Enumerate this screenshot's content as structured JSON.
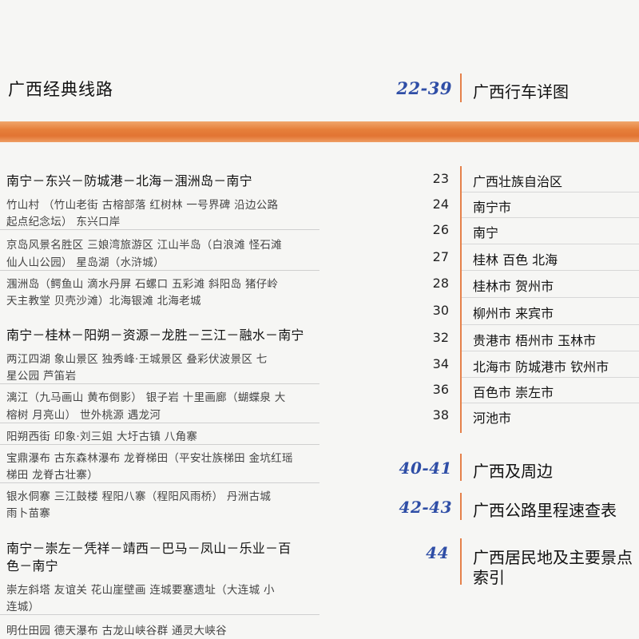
{
  "header": {
    "left_title": "广西经典线路",
    "right_page": "22-39",
    "right_title": "广西行车详图"
  },
  "routes": [
    {
      "title": "南宁－东兴－防城港－北海－涠洲岛－南宁",
      "desc": [
        [
          "竹山村 （竹山老街 古榕部落 红树林 一号界碑 沿边公路",
          "起点纪念坛） 东兴口岸"
        ],
        [
          "京岛风景名胜区 三娘湾旅游区 江山半岛（白浪滩 怪石滩",
          "仙人山公园） 星岛湖（水浒城）"
        ],
        [
          "涠洲岛（鳄鱼山 滴水丹屏 石螺口 五彩滩 斜阳岛 猪仔岭",
          "天主教堂 贝壳沙滩）北海银滩 北海老城"
        ]
      ]
    },
    {
      "title": "南宁－桂林－阳朔－资源－龙胜－三江－融水－南宁",
      "desc": [
        [
          "两江四湖 象山景区 独秀峰·王城景区 叠彩伏波景区 七",
          "星公园 芦笛岩"
        ],
        [
          "漓江（九马画山 黄布倒影） 银子岩 十里画廊（蝴蝶泉 大",
          "榕树 月亮山） 世外桃源 遇龙河"
        ],
        [
          "阳朔西街 印象·刘三姐 大圩古镇 八角寨"
        ],
        [
          "宝鼎瀑布 古东森林瀑布 龙脊梯田（平安壮族梯田 金坑红瑶",
          "梯田 龙脊古壮寨）"
        ],
        [
          "银水侗寨 三江鼓楼 程阳八寨（程阳风雨桥） 丹洲古城",
          "雨卜苗寨"
        ]
      ]
    },
    {
      "title_lines": [
        "南宁－崇左－凭祥－靖西－巴马－凤山－乐业－百",
        "色－南宁"
      ],
      "desc": [
        [
          "崇左斜塔 友谊关 花山崖壁画 连城要塞遗址（大连城 小",
          "连城）"
        ],
        [
          "明仕田园 德天瀑布 古龙山峡谷群 通灵大峡谷"
        ]
      ]
    }
  ],
  "index": [
    {
      "page": "23",
      "name": "广西壮族自治区"
    },
    {
      "page": "24",
      "name": "南宁市"
    },
    {
      "page": "26",
      "name": "南宁"
    },
    {
      "page": "27",
      "name": "桂林 百色 北海"
    },
    {
      "page": "28",
      "name": "桂林市 贺州市"
    },
    {
      "page": "30",
      "name": "柳州市 来宾市"
    },
    {
      "page": "32",
      "name": "贵港市 梧州市 玉林市"
    },
    {
      "page": "34",
      "name": "北海市 防城港市 钦州市"
    },
    {
      "page": "36",
      "name": "百色市 崇左市"
    },
    {
      "page": "38",
      "name": "河池市"
    }
  ],
  "sections": [
    {
      "page": "40-41",
      "title": "广西及周边"
    },
    {
      "page": "42-43",
      "title": "广西公路里程速查表"
    },
    {
      "page": "44",
      "title_lines": [
        "广西居民地及主要景点",
        "索引"
      ]
    }
  ],
  "colors": {
    "accent_orange": "#e67f3a",
    "page_blue": "#2f4ea6"
  }
}
